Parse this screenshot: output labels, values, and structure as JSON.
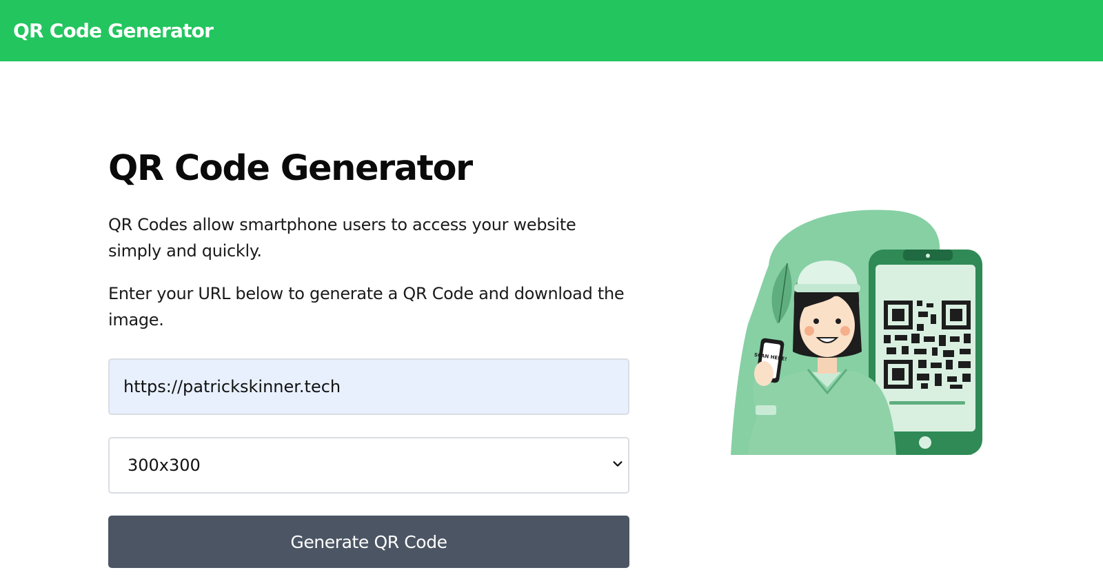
{
  "navbar": {
    "brand": "QR Code Generator"
  },
  "main": {
    "title": "QR Code Generator",
    "paragraphs": [
      "QR Codes allow smartphone users to access your website simply and quickly.",
      "Enter your URL below to generate a QR Code and download the image."
    ],
    "url_input": {
      "value": "https://patrickskinner.tech"
    },
    "size_select": {
      "selected": "300x300"
    },
    "generate_button": "Generate QR Code"
  },
  "illustration": {
    "phone_sign": "SCAN HERE!",
    "icon": "person-scanning-qr-code-illustration"
  },
  "colors": {
    "brand_green": "#22c55e",
    "button_gray": "#4b5563",
    "input_fill": "#e8f0fe",
    "illustration_green": "#86d0a4",
    "illustration_dark": "#2f8a55"
  }
}
